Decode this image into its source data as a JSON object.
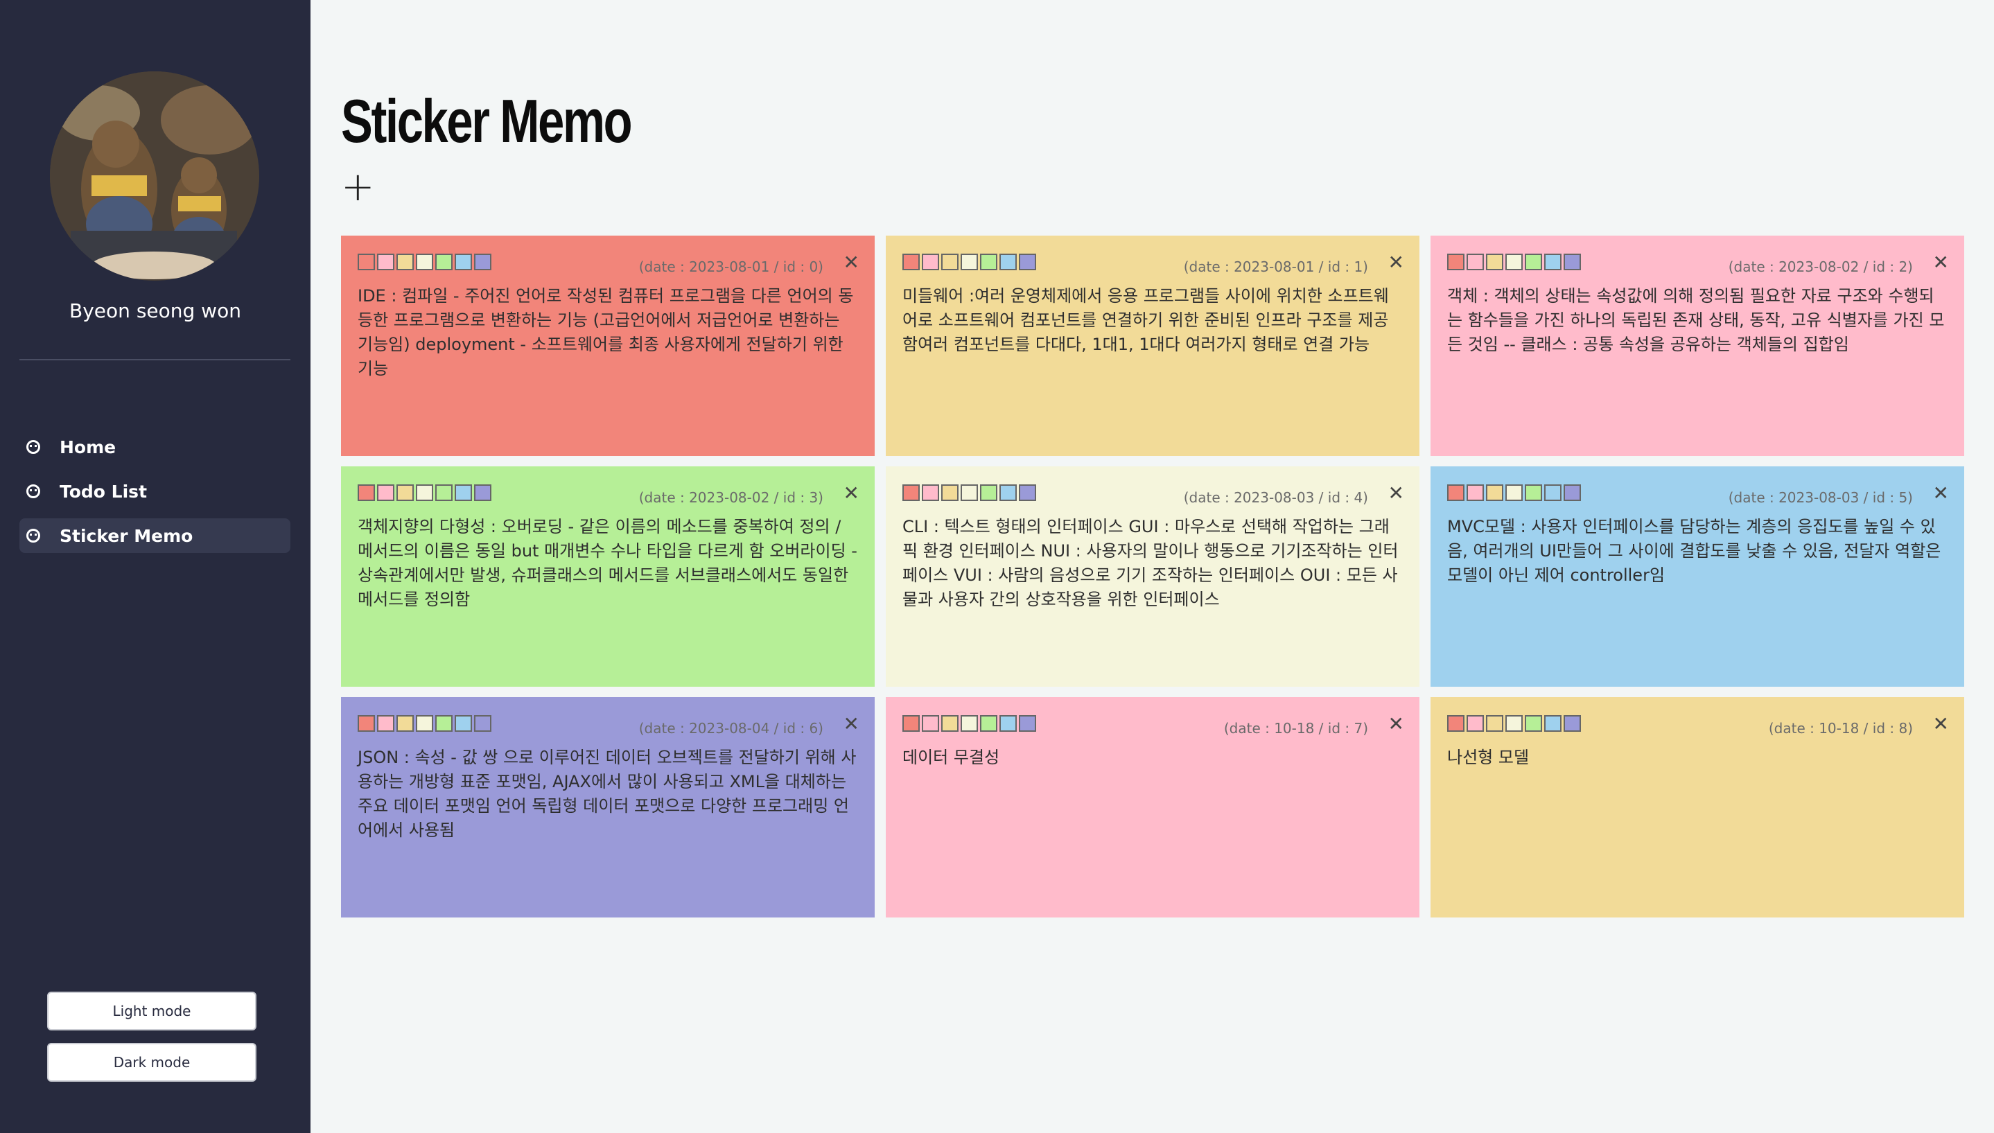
{
  "sidebar": {
    "username": "Byeon seong won",
    "nav": [
      {
        "label": "Home",
        "active": false
      },
      {
        "label": "Todo List",
        "active": false
      },
      {
        "label": "Sticker Memo",
        "active": true
      }
    ],
    "light_mode_label": "Light mode",
    "dark_mode_label": "Dark mode"
  },
  "main": {
    "title": "Sticker Memo",
    "add_label": "+"
  },
  "palette": [
    "#f2857a",
    "#ffbbcb",
    "#f2db98",
    "#f5f5dc",
    "#b6ef97",
    "#9fd1ee",
    "#9a9ad8"
  ],
  "memos": [
    {
      "color": "#f2857a",
      "meta": "(date : 2023-08-01 / id : 0)",
      "text": "IDE : 컴파일 - 주어진 언어로 작성된 컴퓨터 프로그램을 다른 언어의 동등한 프로그램으로 변환하는 기능 (고급언어에서 저급언어로 변환하는 기능임) deployment - 소프트웨어를 최종 사용자에게 전달하기 위한 기능"
    },
    {
      "color": "#f2db98",
      "meta": "(date : 2023-08-01 / id : 1)",
      "text": "미들웨어 :여러 운영체제에서 응용 프로그램들 사이에 위치한 소프트웨어로 소프트웨어 컴포넌트를 연결하기 위한 준비된 인프라 구조를 제공함여러 컴포넌트를 다대다, 1대1, 1대다 여러가지 형태로 연결 가능"
    },
    {
      "color": "#ffbbcb",
      "meta": "(date : 2023-08-02 / id : 2)",
      "text": "객체 : 객체의 상태는 속성값에 의해 정의됨 필요한 자료 구조와 수행되는 함수들을 가진 하나의 독립된 존재 상태, 동작, 고유 식별자를 가진 모든 것임 -- 클래스 : 공통 속성을 공유하는 객체들의 집합임"
    },
    {
      "color": "#b6ef97",
      "meta": "(date : 2023-08-02 / id : 3)",
      "text": "객체지향의 다형성 : 오버로딩 - 같은 이름의 메소드를 중복하여 정의 / 메서드의 이름은 동일 but 매개변수 수나 타입을 다르게 함 오버라이딩 - 상속관계에서만 발생, 슈퍼클래스의 메서드를 서브클래스에서도 동일한 메서드를 정의함"
    },
    {
      "color": "#f5f5dc",
      "meta": "(date : 2023-08-03 / id : 4)",
      "text": "CLI : 텍스트 형태의 인터페이스 GUI : 마우스로 선택해 작업하는 그래픽 환경 인터페이스 NUI : 사용자의 말이나 행동으로 기기조작하는 인터페이스 VUI : 사람의 음성으로 기기 조작하는 인터페이스 OUI : 모든 사물과 사용자 간의 상호작용을 위한 인터페이스"
    },
    {
      "color": "#9fd1ee",
      "meta": "(date : 2023-08-03 / id : 5)",
      "text": "MVC모델 : 사용자 인터페이스를 담당하는 계층의 응집도를 높일 수 있음, 여러개의 UI만들어 그 사이에 결합도를 낮출 수 있음, 전달자 역할은 모델이 아닌 제어 controller임"
    },
    {
      "color": "#9a9ad8",
      "meta": "(date : 2023-08-04 / id : 6)",
      "text": "JSON : 속성 - 값 쌍 으로 이루어진 데이터 오브젝트를 전달하기 위해 사용하는 개방형 표준 포맷임, AJAX에서 많이 사용되고 XML을 대체하는 주요 데이터 포맷임 언어 독립형 데이터 포맷으로 다양한 프로그래밍 언어에서 사용됨"
    },
    {
      "color": "#ffbbcb",
      "meta": "(date : 10-18 / id : 7)",
      "text": "데이터 무결성"
    },
    {
      "color": "#f2db98",
      "meta": "(date : 10-18 / id : 8)",
      "text": "나선형 모델"
    }
  ]
}
